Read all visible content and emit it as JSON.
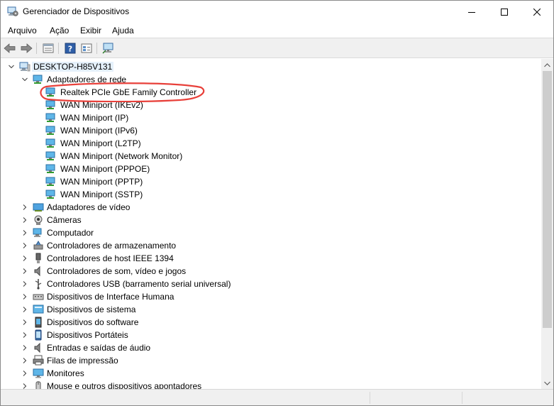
{
  "window": {
    "title": "Gerenciador de Dispositivos",
    "icons": {
      "app": "device-manager-icon",
      "minimize": "minimize-icon",
      "maximize": "maximize-icon",
      "close": "close-icon"
    }
  },
  "menu": {
    "file": "Arquivo",
    "action": "Ação",
    "view": "Exibir",
    "help": "Ajuda"
  },
  "toolbar": {
    "icons": [
      "back-arrow-icon",
      "forward-arrow-icon",
      "properties-grid-icon",
      "help-icon",
      "update-driver-icon",
      "scan-monitor-icon"
    ]
  },
  "tree": {
    "root": "DESKTOP-H85V131",
    "network": {
      "label": "Adaptadores de rede",
      "children": [
        "Realtek PCIe GbE Family Controller",
        "WAN Miniport (IKEv2)",
        "WAN Miniport (IP)",
        "WAN Miniport (IPv6)",
        "WAN Miniport (L2TP)",
        "WAN Miniport (Network Monitor)",
        "WAN Miniport (PPPOE)",
        "WAN Miniport (PPTP)",
        "WAN Miniport (SSTP)"
      ]
    },
    "categories": [
      "Adaptadores de vídeo",
      "Câmeras",
      "Computador",
      "Controladores de armazenamento",
      "Controladores de host IEEE 1394",
      "Controladores de som, vídeo e jogos",
      "Controladores USB (barramento serial universal)",
      "Dispositivos de Interface Humana",
      "Dispositivos de sistema",
      "Dispositivos do software",
      "Dispositivos Portáteis",
      "Entradas e saídas de áudio",
      "Filas de impressão",
      "Monitores",
      "Mouse e outros dispositivos apontadores"
    ]
  },
  "colors": {
    "highlight_ellipse": "#e8403a",
    "selection": "#e5f1fb",
    "network_icon": "#2f9bd6"
  }
}
